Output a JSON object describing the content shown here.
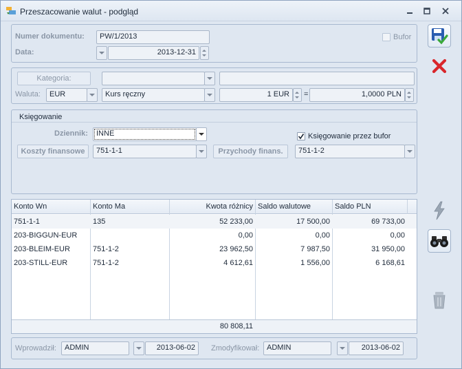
{
  "window": {
    "title": "Przeszacowanie walut - podgląd"
  },
  "header": {
    "doc_number_label": "Numer dokumentu:",
    "doc_number_value": "PW/1/2013",
    "bufor_label": "Bufor",
    "bufor_checked": false,
    "date_label": "Data:",
    "date_value": "2013-12-31"
  },
  "currency": {
    "kategoria_label": "Kategoria:",
    "kategoria_value": "",
    "kategoria_desc": "",
    "waluta_label": "Waluta:",
    "waluta_value": "EUR",
    "kurs_value": "Kurs ręczny",
    "rate_foreign": "1 EUR",
    "equals": "=",
    "rate_pln": "1,0000 PLN"
  },
  "ksiegowanie": {
    "legend": "Księgowanie",
    "dziennik_label": "Dziennik:",
    "dziennik_value": "INNE",
    "bufor_post_label": "Księgowanie przez bufor",
    "bufor_post_checked": true,
    "koszty_label": "Koszty finansowe",
    "koszty_value": "751-1-1",
    "przychody_label": "Przychody finans.",
    "przychody_value": "751-1-2"
  },
  "table": {
    "columns": [
      "Konto Wn",
      "Konto Ma",
      "Kwota różnicy",
      "Saldo walutowe",
      "Saldo PLN"
    ],
    "rows": [
      [
        "751-1-1",
        "135",
        "52 233,00",
        "17 500,00",
        "69 733,00"
      ],
      [
        "203-BIGGUN-EUR",
        "",
        "0,00",
        "0,00",
        "0,00"
      ],
      [
        "203-BLEIM-EUR",
        "751-1-2",
        "23 962,50",
        "7 987,50",
        "31 950,00"
      ],
      [
        "203-STILL-EUR",
        "751-1-2",
        "4 612,61",
        "1 556,00",
        "6 168,61"
      ]
    ],
    "footer_total": "80 808,11"
  },
  "footer": {
    "wprowadzil_label": "Wprowadził:",
    "wprowadzil_value": "ADMIN",
    "wprowadzil_date": "2013-06-02",
    "zmodyfikowal_label": "Zmodyfikował:",
    "zmodyfikowal_value": "ADMIN",
    "zmodyfikowal_date": "2013-06-02"
  },
  "icons": {
    "save": "save-icon",
    "cancel": "cancel-icon",
    "lightning": "lightning-icon",
    "binoculars": "binoculars-icon",
    "trash": "trash-icon"
  },
  "colors": {
    "window_bg": "#dfe7f1",
    "cancel_red": "#d9262b",
    "save_blue": "#2a5db0",
    "check_green": "#3aa83a"
  }
}
